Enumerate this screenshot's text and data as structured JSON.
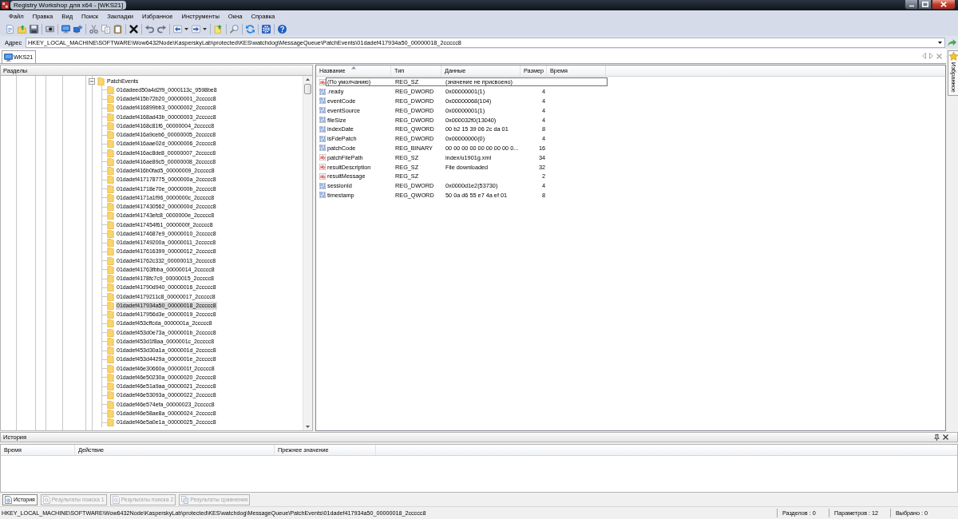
{
  "window": {
    "title": "Registry Workshop для x64 - [WKS21]"
  },
  "menu": [
    "Файл",
    "Правка",
    "Вид",
    "Поиск",
    "Закладки",
    "Избранное",
    "Инструменты",
    "Окна",
    "Справка"
  ],
  "address": {
    "label": "Адрес",
    "value": "HKEY_LOCAL_MACHINE\\SOFTWARE\\Wow6432Node\\KasperskyLab\\protected\\KES\\watchdog\\MessageQueue\\PatchEvents\\01dadef417934a50_00000018_2ccccc8"
  },
  "document_tabs": [
    {
      "label": "WKS21",
      "selected": true
    }
  ],
  "favorites_tab": {
    "label": "Избранное"
  },
  "tree": {
    "title": "Разделы",
    "items": [
      {
        "label": "PatchEvents",
        "expanded": true,
        "selected": false,
        "children": [
          {
            "label": "01dadeed50a4d2f9_0000113c_9598be8",
            "selected": false
          },
          {
            "label": "01dadef415b72b20_00000001_2ccccc8",
            "selected": false
          },
          {
            "label": "01dadef416899bb3_00000002_2ccccc8",
            "selected": false
          },
          {
            "label": "01dadef4168ad43b_00000003_2ccccc8",
            "selected": false
          },
          {
            "label": "01dadef4168c81f6_00000004_2ccccc8",
            "selected": false
          },
          {
            "label": "01dadef416a9ceb6_00000005_2ccccc8",
            "selected": false
          },
          {
            "label": "01dadef416aae02d_00000006_2ccccc8",
            "selected": false
          },
          {
            "label": "01dadef416ac8de8_00000007_2ccccc8",
            "selected": false
          },
          {
            "label": "01dadef416ae89c5_00000008_2ccccc8",
            "selected": false
          },
          {
            "label": "01dadef416b0fad5_00000009_2ccccc8",
            "selected": false
          },
          {
            "label": "01dadef417178775_0000000a_2ccccc8",
            "selected": false
          },
          {
            "label": "01dadef41718e70e_0000000b_2ccccc8",
            "selected": false
          },
          {
            "label": "01dadef4171a1f96_0000000c_2ccccc8",
            "selected": false
          },
          {
            "label": "01dadef417430562_0000000d_2ccccc8",
            "selected": false
          },
          {
            "label": "01dadef41743efc8_0000000e_2ccccc8",
            "selected": false
          },
          {
            "label": "01dadef417454f61_0000000f_2ccccc8",
            "selected": false
          },
          {
            "label": "01dadef4174687e9_00000010_2ccccc8",
            "selected": false
          },
          {
            "label": "01dadef41749200a_00000011_2ccccc8",
            "selected": false
          },
          {
            "label": "01dadef417616399_00000012_2ccccc8",
            "selected": false
          },
          {
            "label": "01dadef41762c332_00000013_2ccccc8",
            "selected": false
          },
          {
            "label": "01dadef41763fbba_00000014_2ccccc8",
            "selected": false
          },
          {
            "label": "01dadef4178fc7c9_00000015_2ccccc8",
            "selected": false
          },
          {
            "label": "01dadef41790d940_00000016_2ccccc8",
            "selected": false
          },
          {
            "label": "01dadef4179211c8_00000017_2ccccc8",
            "selected": false
          },
          {
            "label": "01dadef417934a50_00000018_2ccccc8",
            "selected": true
          },
          {
            "label": "01dadef417956d3e_00000019_2ccccc8",
            "selected": false
          },
          {
            "label": "01dadef453cffcda_0000001a_2ccccc8",
            "selected": false
          },
          {
            "label": "01dadef453d0e73a_0000001b_2ccccc8",
            "selected": false
          },
          {
            "label": "01dadef453d1f8aa_0000001c_2ccccc8",
            "selected": false
          },
          {
            "label": "01dadef453d30a1a_0000001d_2ccccc8",
            "selected": false
          },
          {
            "label": "01dadef453d4429a_0000001e_2ccccc8",
            "selected": false
          },
          {
            "label": "01dadef46e30660a_0000001f_2ccccc8",
            "selected": false
          },
          {
            "label": "01dadef46e50230a_00000020_2ccccc8",
            "selected": false
          },
          {
            "label": "01dadef46e51a9aa_00000021_2ccccc8",
            "selected": false
          },
          {
            "label": "01dadef46e53093a_00000022_2ccccc8",
            "selected": false
          },
          {
            "label": "01dadef46e574efa_00000023_2ccccc8",
            "selected": false
          },
          {
            "label": "01dadef46e58ae8a_00000024_2ccccc8",
            "selected": false
          },
          {
            "label": "01dadef46e5a0e1a_00000025_2ccccc8",
            "selected": false
          }
        ]
      }
    ]
  },
  "values": {
    "columns": [
      {
        "label": "Название",
        "sorted": true
      },
      {
        "label": "Тип",
        "sorted": false
      },
      {
        "label": "Данные",
        "sorted": false
      },
      {
        "label": "Размер",
        "sorted": false
      },
      {
        "label": "Время",
        "sorted": false
      }
    ],
    "rows": [
      {
        "kind": "string",
        "name": "(По умолчанию)",
        "type": "REG_SZ",
        "data": "(значение не присвоено)",
        "focused": true
      },
      {
        "kind": "binary",
        "name": ".ready",
        "type": "REG_DWORD",
        "data": "0x00000001(1)",
        "size": "4",
        "focused": false
      },
      {
        "kind": "binary",
        "name": "eventCode",
        "type": "REG_DWORD",
        "data": "0x00000068(104)",
        "size": "4",
        "focused": false
      },
      {
        "kind": "binary",
        "name": "eventSource",
        "type": "REG_DWORD",
        "data": "0x00000001(1)",
        "size": "4",
        "focused": false
      },
      {
        "kind": "binary",
        "name": "fileSize",
        "type": "REG_DWORD",
        "data": "0x000032f0(13040)",
        "size": "4",
        "focused": false
      },
      {
        "kind": "binary",
        "name": "indexDate",
        "type": "REG_QWORD",
        "data": "00 b2 15 39 06 2c da 01",
        "size": "8",
        "focused": false
      },
      {
        "kind": "binary",
        "name": "isFdePatch",
        "type": "REG_DWORD",
        "data": "0x00000000(0)",
        "size": "4",
        "focused": false
      },
      {
        "kind": "binary",
        "name": "patchCode",
        "type": "REG_BINARY",
        "data": "00 00 00 00 00 00 00 00 0...",
        "size": "16",
        "focused": false
      },
      {
        "kind": "string",
        "name": "patchFilePath",
        "type": "REG_SZ",
        "data": "index/u1901g.xml",
        "size": "34",
        "focused": false
      },
      {
        "kind": "string",
        "name": "resultDescription",
        "type": "REG_SZ",
        "data": "File downloaded",
        "size": "32",
        "focused": false
      },
      {
        "kind": "string",
        "name": "resultMessage",
        "type": "REG_SZ",
        "size": "2",
        "focused": false
      },
      {
        "kind": "binary",
        "name": "sessionId",
        "type": "REG_DWORD",
        "data": "0x0000d1e2(53730)",
        "size": "4",
        "focused": false
      },
      {
        "kind": "binary",
        "name": "timestamp",
        "type": "REG_QWORD",
        "data": "50 0a d6 55 e7 4a ef 01",
        "size": "8",
        "focused": false
      }
    ]
  },
  "history": {
    "title": "История",
    "columns": [
      "Время",
      "Действие",
      "Прежнее значение"
    ]
  },
  "bottom_tabs": [
    {
      "kind": "history",
      "label": "История",
      "selected": true,
      "disabled": false
    },
    {
      "kind": "search",
      "label": "Результаты поиска 1",
      "selected": false,
      "disabled": true
    },
    {
      "kind": "search",
      "label": "Результаты поиска 2",
      "selected": false,
      "disabled": true
    },
    {
      "kind": "compare",
      "label": "Результаты сравнения",
      "selected": false,
      "disabled": true
    }
  ],
  "status_bar": {
    "path": "HKEY_LOCAL_MACHINE\\SOFTWARE\\Wow6432Node\\KasperskyLab\\protected\\KES\\watchdog\\MessageQueue\\PatchEvents\\01dadef417934a50_00000018_2ccccc8",
    "counts": [
      "Разделов : 0",
      "Параметров : 12",
      "Выбрано : 0"
    ]
  }
}
